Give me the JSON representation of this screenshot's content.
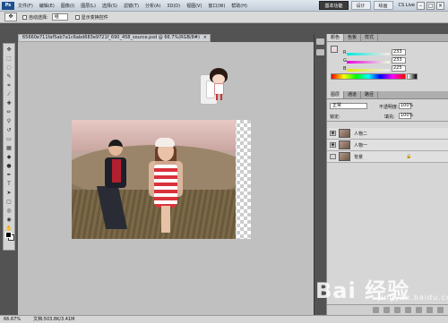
{
  "app": {
    "logo": "Ps",
    "menu": [
      "文件(F)",
      "编辑(E)",
      "图像(I)",
      "图层(L)",
      "选择(S)",
      "滤镜(T)",
      "分析(A)",
      "3D(D)",
      "视图(V)",
      "窗口(W)",
      "帮助(H)"
    ],
    "workspaces": [
      "基本功能",
      "设计",
      "绘画"
    ],
    "active_workspace": "基本功能",
    "cs_live": "CS Live"
  },
  "options": {
    "auto_select_label": "自动选择:",
    "auto_select_value": "组",
    "show_transform_label": "显示变换控件"
  },
  "document": {
    "tab_title": "65660e711faf5ab7a1c6abd683e9721f_690_458_source.psd @ 66.7%(RGB/8#)",
    "close": "×"
  },
  "status": {
    "zoom": "66.67%",
    "doc_size": "文档:503.8K/3.41M"
  },
  "color_panel": {
    "tabs": [
      "颜色",
      "色板",
      "样式"
    ],
    "sliders": [
      {
        "label": "R",
        "value": "233"
      },
      {
        "label": "G",
        "value": "233"
      },
      {
        "label": "B",
        "value": "225"
      }
    ]
  },
  "layers_panel": {
    "tabs": [
      "图层",
      "通道",
      "路径"
    ],
    "blend_mode": "正常",
    "opacity_label": "不透明度:",
    "opacity_value": "100%",
    "lock_label": "锁定:",
    "fill_label": "填充:",
    "fill_value": "100%",
    "layers": [
      {
        "name": "人物二",
        "visible": true,
        "locked": false
      },
      {
        "name": "人物一",
        "visible": true,
        "locked": false
      },
      {
        "name": "背景",
        "visible": false,
        "locked": true
      }
    ]
  },
  "watermark": {
    "brand": "Bai 经验",
    "sub": "jingyan.baidu.com"
  }
}
